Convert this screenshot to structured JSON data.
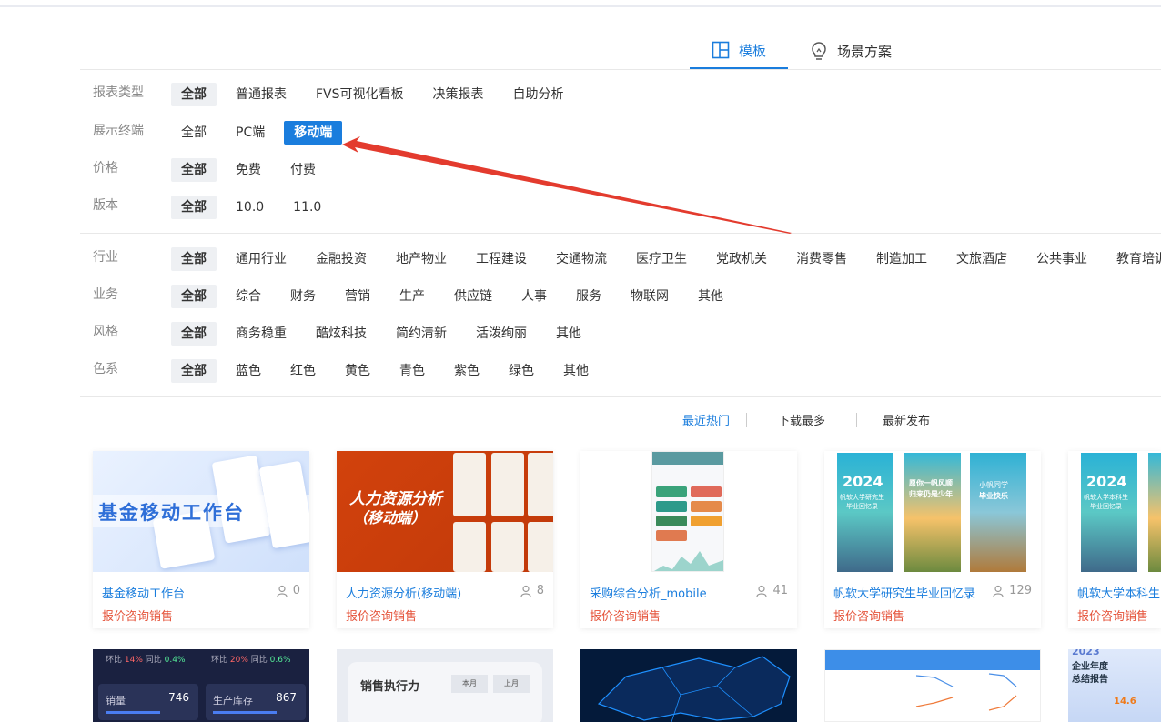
{
  "tabs": [
    {
      "label": "模板",
      "icon": "layout-grid-icon",
      "active": true
    },
    {
      "label": "场景方案",
      "icon": "lightbulb-icon",
      "active": false
    }
  ],
  "filters": {
    "report_type": {
      "label": "报表类型",
      "options": [
        "全部",
        "普通报表",
        "FVS可视化看板",
        "决策报表",
        "自助分析"
      ]
    },
    "terminal": {
      "label": "展示终端",
      "options": [
        "全部",
        "PC端",
        "移动端"
      ]
    },
    "price": {
      "label": "价格",
      "options": [
        "全部",
        "免费",
        "付费"
      ]
    },
    "version": {
      "label": "版本",
      "options": [
        "全部",
        "10.0",
        "11.0"
      ]
    },
    "industry": {
      "label": "行业",
      "options": [
        "全部",
        "通用行业",
        "金融投资",
        "地产物业",
        "工程建设",
        "交通物流",
        "医疗卫生",
        "党政机关",
        "消费零售",
        "制造加工",
        "文旅酒店",
        "公共事业",
        "教育培训"
      ]
    },
    "business": {
      "label": "业务",
      "options": [
        "全部",
        "综合",
        "财务",
        "营销",
        "生产",
        "供应链",
        "人事",
        "服务",
        "物联网",
        "其他"
      ]
    },
    "style": {
      "label": "风格",
      "options": [
        "全部",
        "商务稳重",
        "酷炫科技",
        "简约清新",
        "活泼绚丽",
        "其他"
      ]
    },
    "color": {
      "label": "色系",
      "options": [
        "全部",
        "蓝色",
        "红色",
        "黄色",
        "青色",
        "紫色",
        "绿色",
        "其他"
      ]
    }
  },
  "sort": [
    "最近热门",
    "下载最多",
    "最新发布"
  ],
  "cards": [
    {
      "title": "基金移动工作台",
      "count": "0",
      "sub": "报价咨询销售",
      "thumb_text": "基金移动工作台"
    },
    {
      "title": "人力资源分析(移动端)",
      "count": "8",
      "sub": "报价咨询销售",
      "thumb_text": "人力资源分析",
      "thumb_text2": "（移动端）"
    },
    {
      "title": "采购综合分析_mobile",
      "count": "41",
      "sub": "报价咨询销售"
    },
    {
      "title": "帆软大学研究生毕业回忆录",
      "count": "129",
      "sub": "报价咨询销售",
      "thumb_badges": [
        "2024",
        "帆软大学研究生",
        "毕业回忆录",
        "愿你一帆风顺",
        "归来仍是少年",
        "小帆同学",
        "毕业快乐"
      ]
    },
    {
      "title": "帆软大学本科生",
      "count": "",
      "sub": "报价咨询销售",
      "thumb_badges": [
        "2024",
        "帆软大学本科生",
        "毕业回忆录"
      ]
    }
  ],
  "row2": {
    "c1": {
      "a": "环比",
      "a_val": "14%",
      "b": "同比",
      "b_val": "0.4%",
      "c": "环比",
      "c_val": "20%",
      "d": "同比",
      "d_val": "0.6%",
      "e": "销量",
      "e_val": "746",
      "f": "生产库存",
      "f_val": "867"
    },
    "c2": {
      "title": "销售执行力",
      "btn1": "本月",
      "btn2": "上月"
    },
    "c5": {
      "year": "2023",
      "title": "企业年度",
      "title2": "总结报告",
      "stat": "14.6"
    }
  },
  "colors": {
    "accent": "#1a7ddd",
    "sub": "#e5543b",
    "selected_bg": "#eef0f3",
    "annotation": "#e33b2e"
  }
}
